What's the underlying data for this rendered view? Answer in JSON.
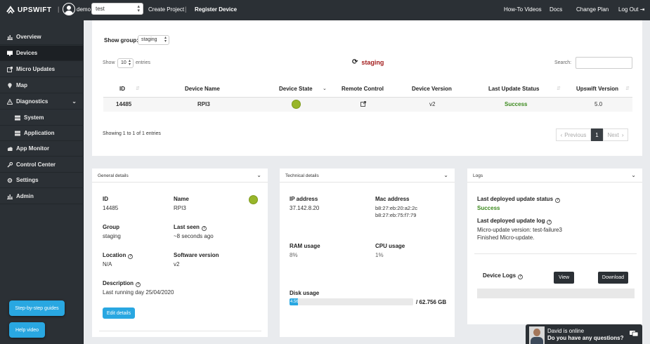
{
  "brand": {
    "name": "UPSWIFT"
  },
  "topnav": {
    "username": "demo",
    "project": "test",
    "create_project": "Create Project",
    "register_device": "Register Device",
    "howto": "How-To Videos",
    "docs": "Docs",
    "change_plan": "Change Plan",
    "logout": "Log Out"
  },
  "sidebar": {
    "items": [
      {
        "label": "Overview",
        "icon": "bar-chart-icon"
      },
      {
        "label": "Devices",
        "icon": "monitor-icon"
      },
      {
        "label": "Micro Updates",
        "icon": "external-link-icon"
      },
      {
        "label": "Map",
        "icon": "map-pin-icon"
      },
      {
        "label": "Diagnostics",
        "icon": "warning-icon"
      },
      {
        "label": "System",
        "icon": "server-icon"
      },
      {
        "label": "Application",
        "icon": "server-icon"
      },
      {
        "label": "App Monitor",
        "icon": "cloud-icon"
      },
      {
        "label": "Control Center",
        "icon": "wrench-icon"
      },
      {
        "label": "Settings",
        "icon": "gear-icon"
      },
      {
        "label": "Admin",
        "icon": "bar-chart-icon"
      }
    ],
    "guide_button": "Step-by-step guides",
    "help_button": "Help video"
  },
  "devices": {
    "show_group_label": "Show group:",
    "group_value": "staging",
    "show_label": "Show",
    "entries_value": "10",
    "entries_label": "entries",
    "group_title": "staging",
    "search_label": "Search:",
    "columns": [
      "ID",
      "Device Name",
      "Device State",
      "Remote Control",
      "Device Version",
      "Last Update Status",
      "Upswift Version"
    ],
    "row": {
      "id": "14485",
      "name": "RPI3",
      "version": "v2",
      "status": "Success",
      "upswift_version": "5.0"
    },
    "showing": "Showing 1 to 1 of 1 entries",
    "prev": "Previous",
    "page": "1",
    "next": "Next"
  },
  "general": {
    "title": "General details",
    "id_label": "ID",
    "id_value": "14485",
    "name_label": "Name",
    "name_value": "RPI3",
    "group_label": "Group",
    "group_value": "staging",
    "last_seen_label": "Last seen",
    "last_seen_value": "~8 seconds ago",
    "location_label": "Location",
    "location_value": "N/A",
    "software_label": "Software version",
    "software_value": "v2",
    "description_label": "Description",
    "description_value": "Last running day 25/04/2020",
    "edit_button": "Edit details"
  },
  "technical": {
    "title": "Technical details",
    "ip_label": "IP address",
    "ip_value": "37.142.8.20",
    "mac_label": "Mac address",
    "mac_1": "b8:27:eb:20:a2:2c",
    "mac_2": "b8:27:eb:75:f7:79",
    "ram_label": "RAM usage",
    "ram_value": "8%",
    "cpu_label": "CPU usage",
    "cpu_value": "1%",
    "disk_label": "Disk usage",
    "disk_fill_text": "4.56",
    "disk_fill_percent": 7,
    "disk_total": "/ 62.756 GB"
  },
  "logs": {
    "title": "Logs",
    "status_label": "Last deployed update status",
    "status_value": "Success",
    "log_label": "Last deployed update log",
    "log_line1": "Micro-update version: test-failure3",
    "log_line2": "Finished Micro-update.",
    "device_logs_label": "Device Logs",
    "view_button": "View",
    "download_button": "Download"
  },
  "chat": {
    "online": "David is online",
    "question": "Do you have any questions?"
  },
  "colors": {
    "accent": "#29a7e1",
    "nav": "#2b3035",
    "success": "#3c8a1e",
    "state_online": "#98b62a"
  }
}
